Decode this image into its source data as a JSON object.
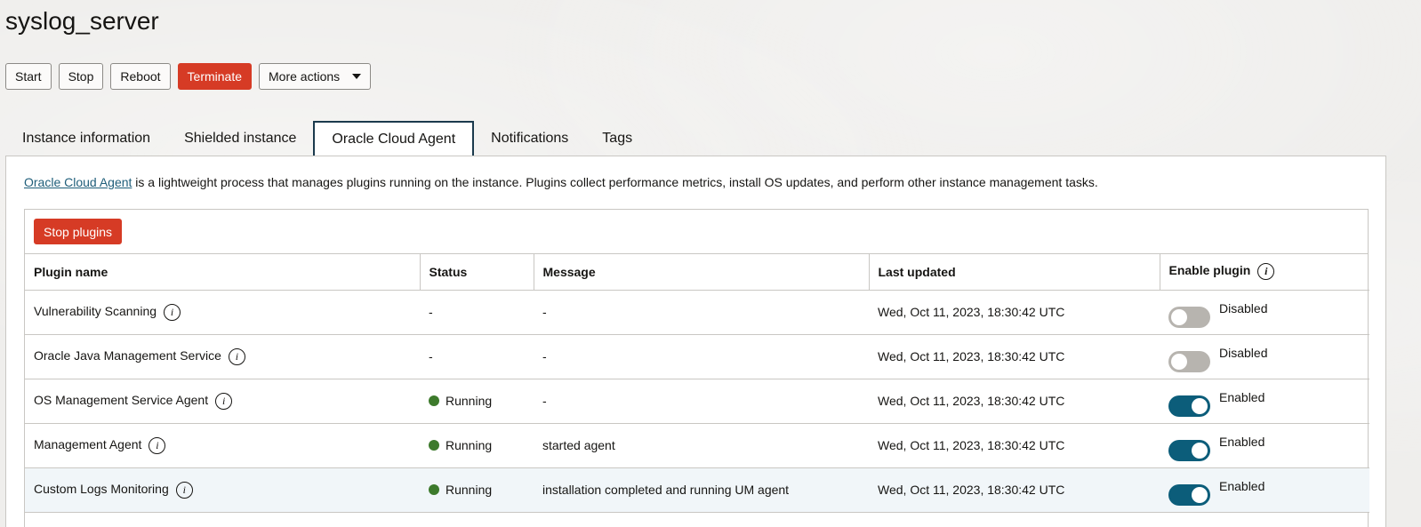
{
  "page": {
    "title": "syslog_server"
  },
  "actions": {
    "start": "Start",
    "stop": "Stop",
    "reboot": "Reboot",
    "terminate": "Terminate",
    "more": "More actions"
  },
  "tabs": [
    {
      "label": "Instance information",
      "active": false
    },
    {
      "label": "Shielded instance",
      "active": false
    },
    {
      "label": "Oracle Cloud Agent",
      "active": true
    },
    {
      "label": "Notifications",
      "active": false
    },
    {
      "label": "Tags",
      "active": false
    }
  ],
  "intro": {
    "link": "Oracle Cloud Agent",
    "text": " is a lightweight process that manages plugins running on the instance. Plugins collect performance metrics, install OS updates, and perform other instance management tasks."
  },
  "toolbar": {
    "stop_plugins": "Stop plugins"
  },
  "table": {
    "headers": [
      "Plugin name",
      "Status",
      "Message",
      "Last updated",
      "Enable plugin"
    ],
    "rows": [
      {
        "name": "Vulnerability Scanning",
        "status": "-",
        "message": "-",
        "updated": "Wed, Oct 11, 2023, 18:30:42 UTC",
        "enabled": "Disabled"
      },
      {
        "name": "Oracle Java Management Service",
        "status": "-",
        "message": "-",
        "updated": "Wed, Oct 11, 2023, 18:30:42 UTC",
        "enabled": "Disabled"
      },
      {
        "name": "OS Management Service Agent",
        "status": "Running",
        "message": "-",
        "updated": "Wed, Oct 11, 2023, 18:30:42 UTC",
        "enabled": "Enabled"
      },
      {
        "name": "Management Agent",
        "status": "Running",
        "message": "started agent",
        "updated": "Wed, Oct 11, 2023, 18:30:42 UTC",
        "enabled": "Enabled"
      },
      {
        "name": "Custom Logs Monitoring",
        "status": "Running",
        "message": "installation completed and running UM agent",
        "updated": "Wed, Oct 11, 2023, 18:30:42 UTC",
        "enabled": "Enabled"
      }
    ]
  },
  "colors": {
    "danger": "#d63b25",
    "toggle_on": "#0c5d7a",
    "running": "#3d7a2c",
    "link": "#1f5e7a"
  },
  "icons": {
    "info": "info-icon",
    "more_actions": "chevron-down-icon"
  }
}
